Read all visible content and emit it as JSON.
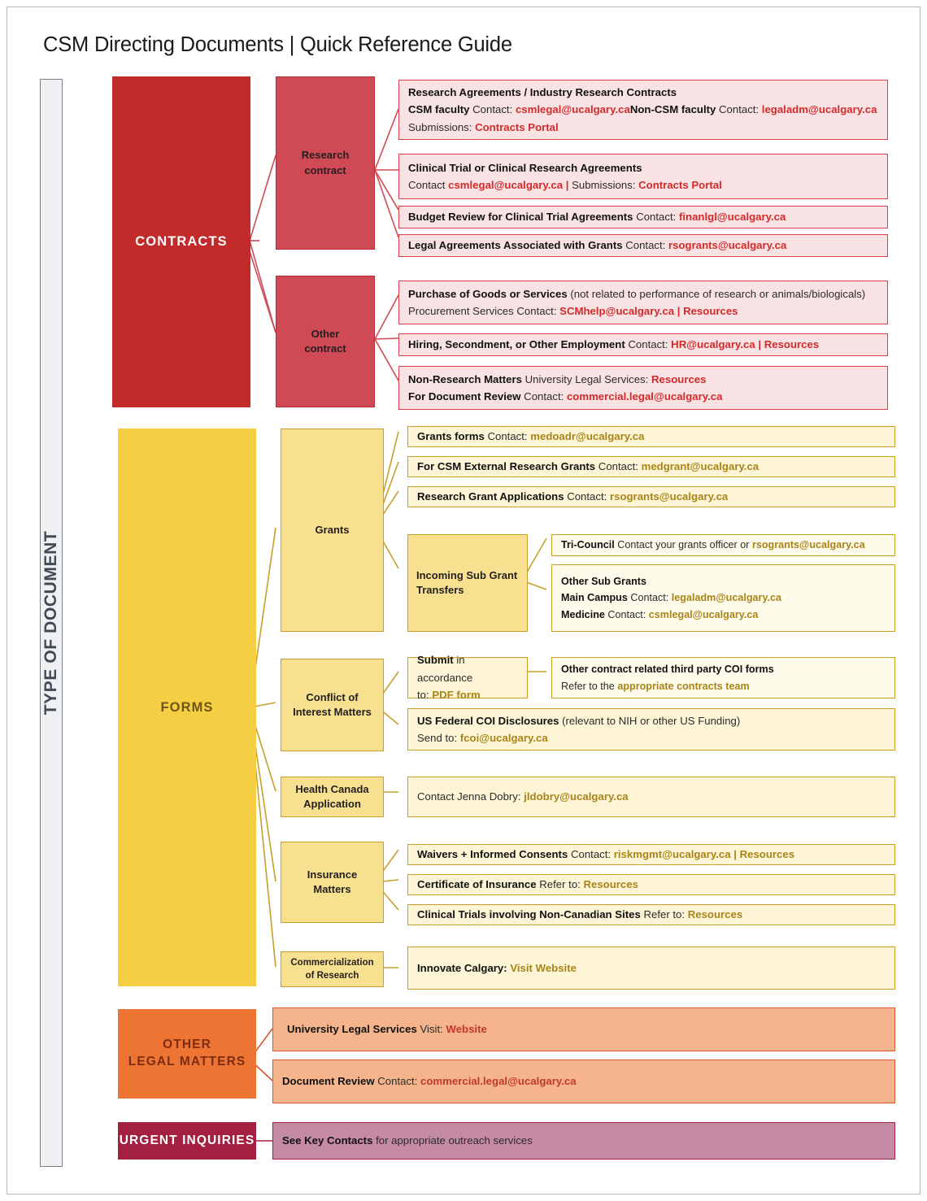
{
  "title": "CSM Directing Documents | Quick Reference Guide",
  "spine": {
    "label": "TYPE OF DOCUMENT"
  },
  "colors": {
    "contracts": "#C32A2A",
    "research_contract": "#CF4A55",
    "forms": "#F5CE43",
    "forms_mid": "#F7E190",
    "other_legal": "#EE7433",
    "urgent": "#A32040",
    "red_link": "#D42A2A",
    "gold_link": "#A98419",
    "detail_red_bg": "#F8E2E4",
    "detail_gold_bg": "#FDF5D5",
    "detail_orange_bg": "#F6B48C",
    "detail_purple_bg": "#C58AA4"
  },
  "categories": {
    "contracts": "CONTRACTS",
    "forms": "FORMS",
    "other_legal_line1": "OTHER",
    "other_legal_line2": "LEGAL MATTERS",
    "urgent": "URGENT INQUIRIES"
  },
  "mid": {
    "research_contract_l1": "Research",
    "research_contract_l2": "contract",
    "other_contract_l1": "Other",
    "other_contract_l2": "contract",
    "grants": "Grants",
    "incoming_sub_grant_l1": "Incoming Sub Grant",
    "incoming_sub_grant_l2": "Transfers",
    "coi_l1": "Conflict of",
    "coi_l2": "Interest Matters",
    "health_canada_l1": "Health Canada",
    "health_canada_l2": "Application",
    "insurance_l1": "Insurance",
    "insurance_l2": "Matters",
    "commercialization_l1": "Commercialization",
    "commercialization_l2": "of Research",
    "coi_submit_l1_bold": "Submit",
    "coi_submit_l1_rest": " in accordance",
    "coi_submit_l2_pre": "to: ",
    "coi_submit_l2_link": "PDF form"
  },
  "contracts": {
    "research_agreements": {
      "line1": "Research Agreements / Industry Research Contracts",
      "l2_a_bold": "CSM faculty",
      "l2_a_label": " Contact:  ",
      "l2_a_email": "csmlegal@ucalgary.ca",
      "l2_b_bold": "Non-CSM faculty",
      "l2_b_label": "  Contact:  ",
      "l2_b_email": "legaladm@ucalgary.ca",
      "l3_label": "Submissions: ",
      "l3_link": "Contracts Portal"
    },
    "clinical_trial": {
      "line1": "Clinical Trial or Clinical Research Agreements",
      "l2_label": "Contact  ",
      "l2_email": "csmlegal@ucalgary.ca",
      "l2_sep": "  |  ",
      "l2_label2": "Submissions:  ",
      "l2_link": "Contracts Portal"
    },
    "budget_review": {
      "bold": "Budget Review for Clinical Trial Agreements",
      "label": "  Contact: ",
      "email": "finanlgl@ucalgary.ca"
    },
    "legal_grants": {
      "bold": "Legal Agreements Associated with Grants",
      "label": "  Contact: ",
      "email": "rsogrants@ucalgary.ca"
    },
    "purchase_goods": {
      "l1_bold": "Purchase of Goods or Services",
      "l1_rest": " (not related to performance of research or animals/biologicals)",
      "l2_label": "Procurement Services Contact: ",
      "l2_email": "SCMhelp@ucalgary.ca",
      "l2_sep": "   |   ",
      "l2_link": "Resources"
    },
    "hiring": {
      "bold": "Hiring, Secondment, or Other Employment",
      "label": " Contact: ",
      "email": "HR@ucalgary.ca",
      "sep": "   |   ",
      "link": "Resources"
    },
    "non_research": {
      "l1_bold": "Non-Research Matters",
      "l1_label": " University Legal Services: ",
      "l1_link": "Resources",
      "l2_bold": "For Document Review",
      "l2_label": " Contact: ",
      "l2_email": "commercial.legal@ucalgary.ca"
    }
  },
  "forms": {
    "grants_forms": {
      "bold": "Grants forms",
      "label": " Contact: ",
      "email": "medoadr@ucalgary.ca"
    },
    "csm_external": {
      "bold": "For CSM External Research Grants",
      "label": " Contact: ",
      "email": "medgrant@ucalgary.ca"
    },
    "grant_applications": {
      "bold": "Research Grant Applications",
      "label": " Contact: ",
      "email": "rsogrants@ucalgary.ca"
    },
    "tri_council": {
      "bold": "Tri-Council",
      "label": " Contact your grants officer or ",
      "email": "rsogrants@ucalgary.ca"
    },
    "other_sub_grants": {
      "line1": "Other Sub Grants",
      "l2_bold": "Main Campus",
      "l2_label": " Contact: ",
      "l2_email": "legaladm@ucalgary.ca",
      "l3_bold": "Medicine",
      "l3_label": " Contact: ",
      "l3_email": "csmlegal@ucalgary.ca"
    },
    "third_party_coi": {
      "line1": "Other contract related third party COI forms",
      "l2_label": "Refer to the ",
      "l2_link": "appropriate contracts team"
    },
    "us_federal_coi": {
      "l1_bold": "US Federal COI Disclosures",
      "l1_rest": " (relevant to NIH or other US Funding)",
      "l2_label": "Send to: ",
      "l2_email": "fcoi@ucalgary.ca"
    },
    "health_canada": {
      "label": "Contact Jenna Dobry: ",
      "email": "jldobry@ucalgary.ca"
    },
    "waivers": {
      "bold": "Waivers + Informed Consents",
      "label": " Contact: ",
      "email": "riskmgmt@ucalgary.ca",
      "sep": "   |   ",
      "link": "Resources"
    },
    "certificate": {
      "bold": "Certificate of Insurance",
      "label": " Refer to: ",
      "link": "Resources"
    },
    "clinical_non_canadian": {
      "bold": "Clinical Trials involving Non-Canadian Sites",
      "label": " Refer to:  ",
      "link": "Resources"
    },
    "innovate": {
      "bold": "Innovate Calgary:",
      "link": "  Visit Website"
    }
  },
  "other_legal": {
    "university_legal": {
      "bold": "University Legal Services",
      "label": " Visit: ",
      "link": "Website"
    },
    "document_review": {
      "bold": "Document Review",
      "label": " Contact:  ",
      "email": "commercial.legal@ucalgary.ca"
    }
  },
  "urgent_detail": {
    "bold": "See Key Contacts",
    "rest": " for appropriate outreach services"
  }
}
